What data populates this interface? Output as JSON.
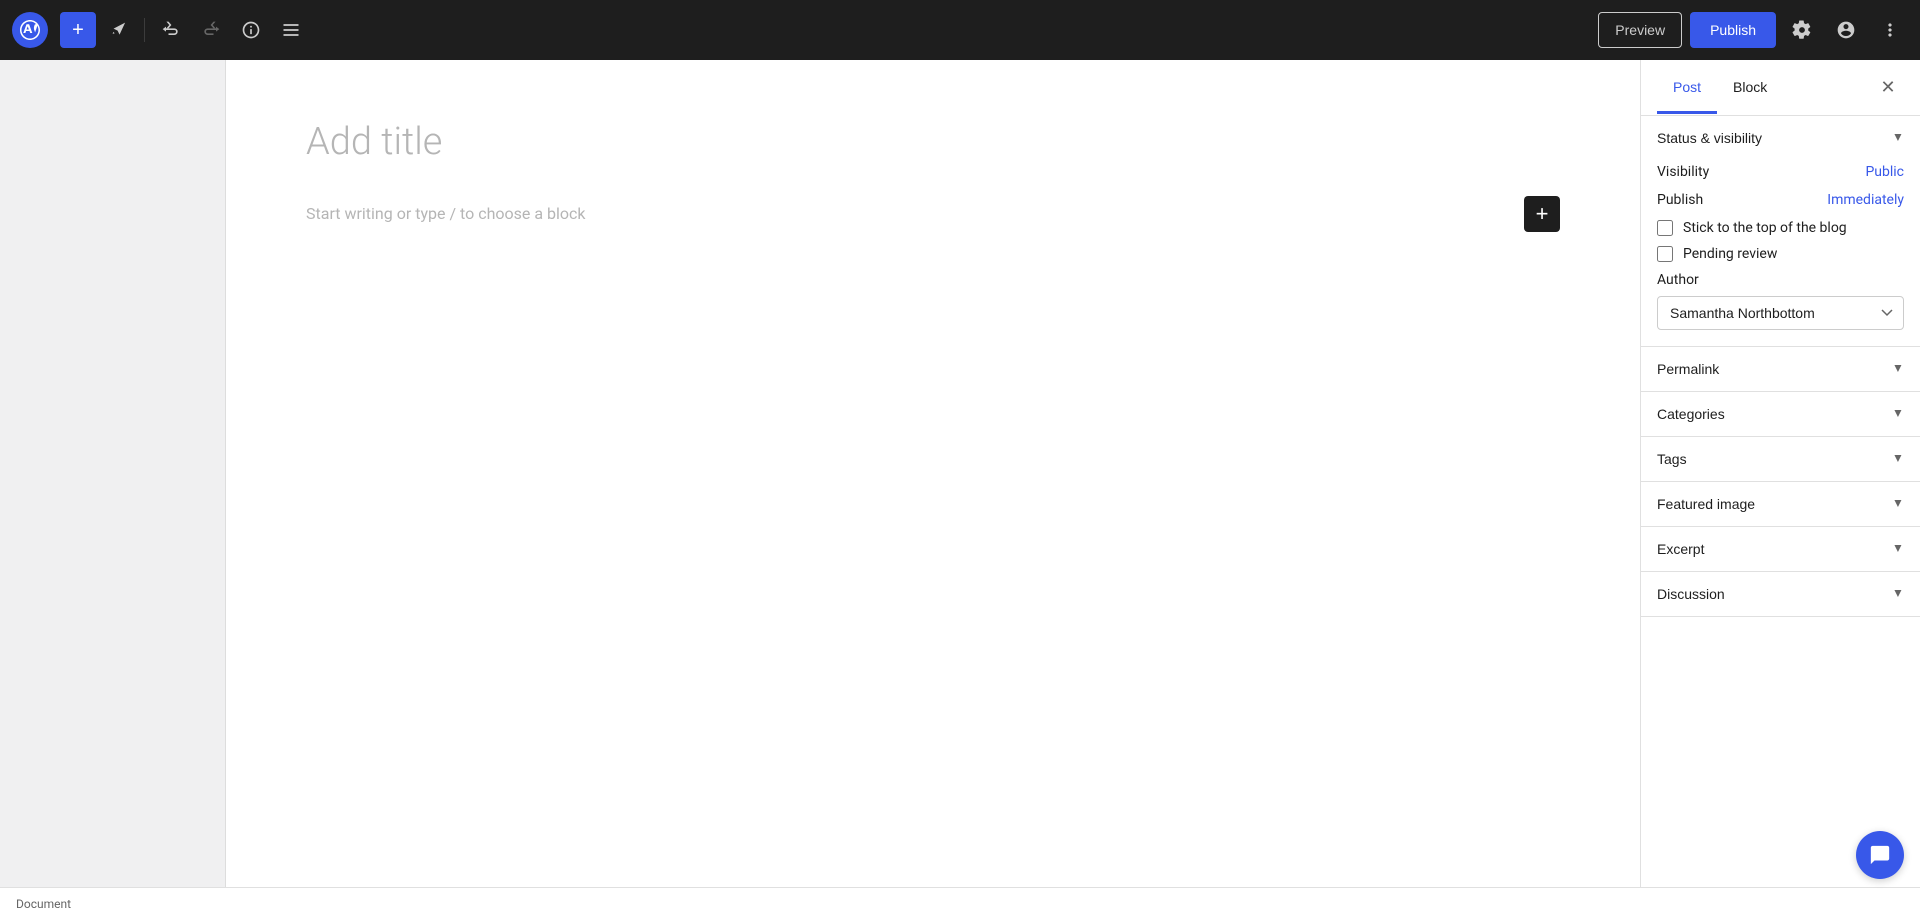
{
  "toolbar": {
    "add_label": "+",
    "preview_label": "Preview",
    "publish_label": "Publish",
    "undo_title": "Undo",
    "redo_title": "Redo",
    "info_title": "Details",
    "list_title": "List View"
  },
  "editor": {
    "title_placeholder": "Add title",
    "block_placeholder": "Start writing or type / to choose a block"
  },
  "sidebar": {
    "tab_post": "Post",
    "tab_block": "Block",
    "sections": {
      "status_visibility": {
        "title": "Status & visibility",
        "visibility_label": "Visibility",
        "visibility_value": "Public",
        "publish_label": "Publish",
        "publish_value": "Immediately",
        "stick_label": "Stick to the top of the blog",
        "pending_label": "Pending review",
        "author_label": "Author",
        "author_value": "Samantha Northbottom"
      },
      "permalink": {
        "title": "Permalink"
      },
      "categories": {
        "title": "Categories"
      },
      "tags": {
        "title": "Tags"
      },
      "featured_image": {
        "title": "Featured image"
      },
      "excerpt": {
        "title": "Excerpt"
      },
      "discussion": {
        "title": "Discussion"
      }
    }
  },
  "status_bar": {
    "document_label": "Document"
  }
}
